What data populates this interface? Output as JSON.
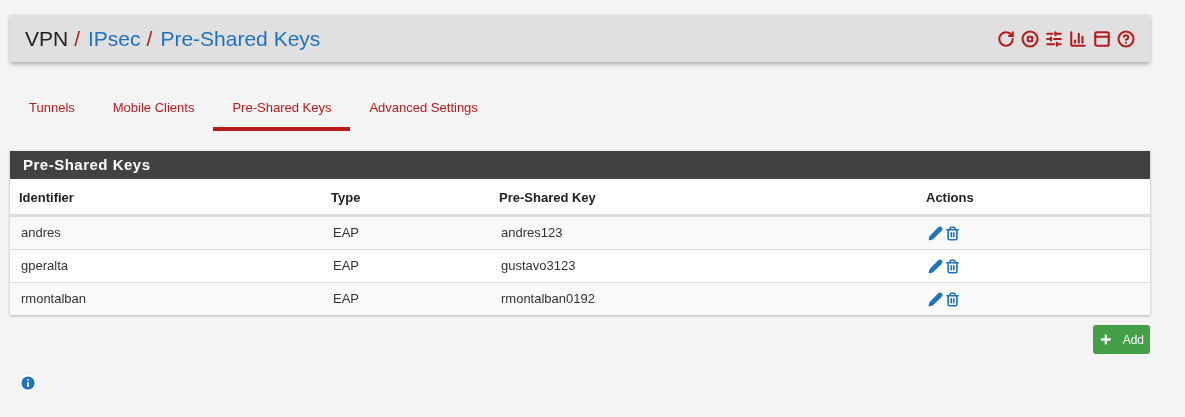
{
  "breadcrumb": [
    {
      "label": "VPN",
      "kind": "plain"
    },
    {
      "label": "/",
      "kind": "separator"
    },
    {
      "label": "IPsec",
      "kind": "link"
    },
    {
      "label": "/",
      "kind": "separator"
    },
    {
      "label": "Pre-Shared Keys",
      "kind": "link"
    }
  ],
  "tabs": [
    {
      "label": "Tunnels",
      "selected": false
    },
    {
      "label": "Mobile Clients",
      "selected": false
    },
    {
      "label": "Pre-Shared Keys",
      "selected": true
    },
    {
      "label": "Advanced Settings",
      "selected": false
    }
  ],
  "panel": {
    "title": "Pre-Shared Keys",
    "columns": [
      "Identifier",
      "Type",
      "Pre-Shared Key",
      "Actions"
    ],
    "rows": [
      {
        "identifier": "andres",
        "type": "EAP",
        "key": "andres123"
      },
      {
        "identifier": "gperalta",
        "type": "EAP",
        "key": "gustavo3123"
      },
      {
        "identifier": "rmontalban",
        "type": "EAP",
        "key": "rmontalban0192"
      }
    ]
  },
  "add_button": "Add"
}
